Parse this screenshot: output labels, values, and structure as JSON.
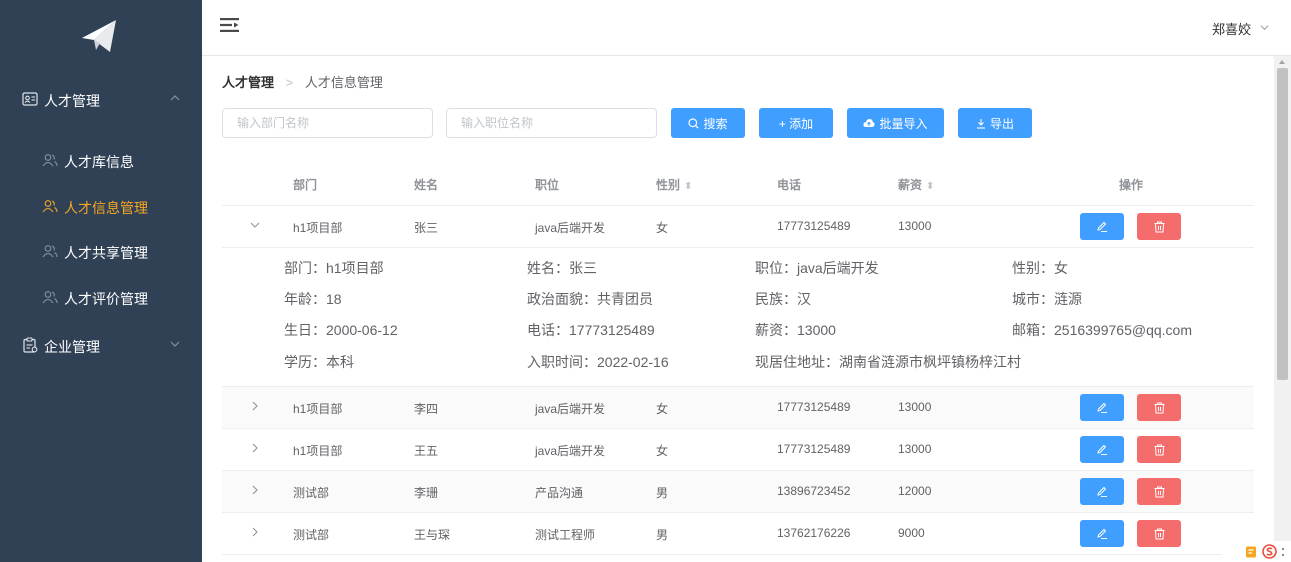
{
  "sidebar": {
    "groups": [
      {
        "label": "人才管理",
        "icon": "id-card-icon",
        "expanded": true
      },
      {
        "label": "企业管理",
        "icon": "clipboard-icon",
        "expanded": false
      }
    ],
    "items": [
      {
        "label": "人才库信息"
      },
      {
        "label": "人才信息管理",
        "active": true
      },
      {
        "label": "人才共享管理"
      },
      {
        "label": "人才评价管理"
      }
    ],
    "active_color": "#f5a623"
  },
  "header": {
    "username": "郑喜姣"
  },
  "breadcrumb": {
    "first": "人才管理",
    "separator": ">",
    "second": "人才信息管理"
  },
  "filters": {
    "dept_placeholder": "输入部门名称",
    "position_placeholder": "输入职位名称"
  },
  "toolbar": {
    "search_label": "搜索",
    "add_label": "+ 添加",
    "import_label": "批量导入",
    "export_label": "导出"
  },
  "table": {
    "headers": {
      "dept": "部门",
      "name": "姓名",
      "position": "职位",
      "gender": "性别",
      "phone": "电话",
      "salary": "薪资",
      "actions": "操作"
    },
    "rows": [
      {
        "dept": "h1项目部",
        "name": "张三",
        "position": "java后端开发",
        "gender": "女",
        "phone": "17773125489",
        "salary": "13000",
        "expanded": true
      },
      {
        "dept": "h1项目部",
        "name": "李四",
        "position": "java后端开发",
        "gender": "女",
        "phone": "17773125489",
        "salary": "13000"
      },
      {
        "dept": "h1项目部",
        "name": "王五",
        "position": "java后端开发",
        "gender": "女",
        "phone": "17773125489",
        "salary": "13000"
      },
      {
        "dept": "测试部",
        "name": "李珊",
        "position": "产品沟通",
        "gender": "男",
        "phone": "13896723452",
        "salary": "12000"
      },
      {
        "dept": "测试部",
        "name": "王与琛",
        "position": "测试工程师",
        "gender": "男",
        "phone": "13762176226",
        "salary": "9000"
      }
    ],
    "detail": {
      "dept": "部门：h1项目部",
      "name": "姓名：张三",
      "position": "职位：java后端开发",
      "gender": "性别：女",
      "age": "年龄：18",
      "political": "政治面貌：共青团员",
      "ethnicity": "民族：汉",
      "city": "城市：涟源",
      "birthday": "生日：2000-06-12",
      "phone": "电话：17773125489",
      "salary": "薪资：13000",
      "email": "邮箱：2516399765@qq.com",
      "education": "学历：本科",
      "join_date": "入职时间：2022-02-16",
      "address": "现居住地址：湖南省涟源市枫坪镇杨梓江村"
    }
  },
  "colors": {
    "sidebar_bg": "#304156",
    "primary": "#409eff",
    "danger": "#f56c6c"
  }
}
